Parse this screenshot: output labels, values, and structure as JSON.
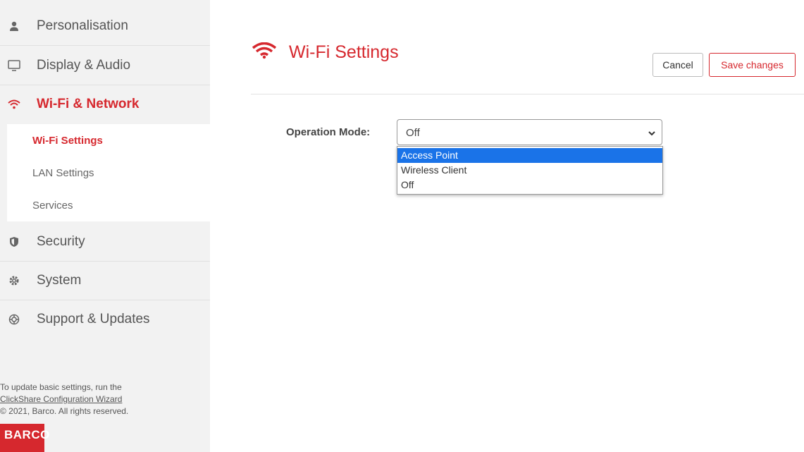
{
  "sidebar": {
    "items": [
      {
        "label": "Personalisation",
        "icon": "person-icon"
      },
      {
        "label": "Display & Audio",
        "icon": "monitor-icon"
      },
      {
        "label": "Wi-Fi & Network",
        "icon": "wifi-icon"
      },
      {
        "label": "Security",
        "icon": "shield-icon"
      },
      {
        "label": "System",
        "icon": "gear-icon"
      },
      {
        "label": "Support & Updates",
        "icon": "lifebuoy-icon"
      }
    ],
    "submenu": [
      {
        "label": "Wi-Fi Settings"
      },
      {
        "label": "LAN Settings"
      },
      {
        "label": "Services"
      }
    ],
    "footer": {
      "line1": "To update basic settings, run the",
      "link": "ClickShare Configuration Wizard",
      "copyright": "© 2021, Barco. All rights reserved."
    },
    "logo_text": "BARCO"
  },
  "header": {
    "title": "Wi-Fi Settings",
    "cancel_label": "Cancel",
    "save_label": "Save changes"
  },
  "form": {
    "operation_mode_label": "Operation Mode:",
    "operation_mode_value": "Off",
    "options": [
      "Access Point",
      "Wireless Client",
      "Off"
    ],
    "highlighted_option": "Access Point"
  },
  "colors": {
    "accent": "#d6282e",
    "highlight": "#1a73e8",
    "sidebar_bg": "#f2f2f2"
  }
}
